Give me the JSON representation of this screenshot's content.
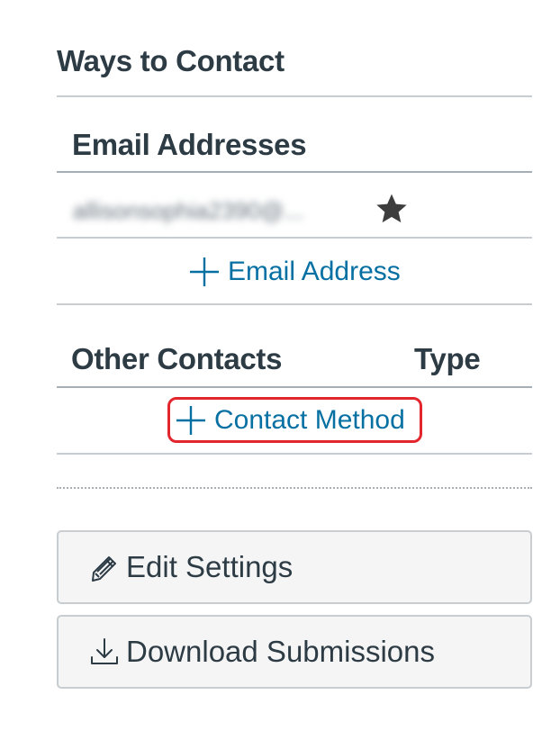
{
  "ways_to_contact": {
    "title": "Ways to Contact"
  },
  "email_section": {
    "header": "Email Addresses",
    "email_value": "allisonsophia2390@...",
    "default_icon": "star-icon",
    "add_label": "Email Address",
    "add_icon": "plus-icon"
  },
  "other_contacts": {
    "header": "Other Contacts",
    "type_header": "Type",
    "add_label": "Contact Method",
    "add_icon": "plus-icon",
    "highlight_color": "#e3262d"
  },
  "buttons": {
    "edit_settings": {
      "label": "Edit Settings",
      "icon": "pencil-icon"
    },
    "download_submissions": {
      "label": "Download Submissions",
      "icon": "download-icon"
    }
  },
  "colors": {
    "text": "#2d3b45",
    "link": "#0770a3",
    "button_bg": "#f5f5f5",
    "border": "#c7cdd1"
  }
}
